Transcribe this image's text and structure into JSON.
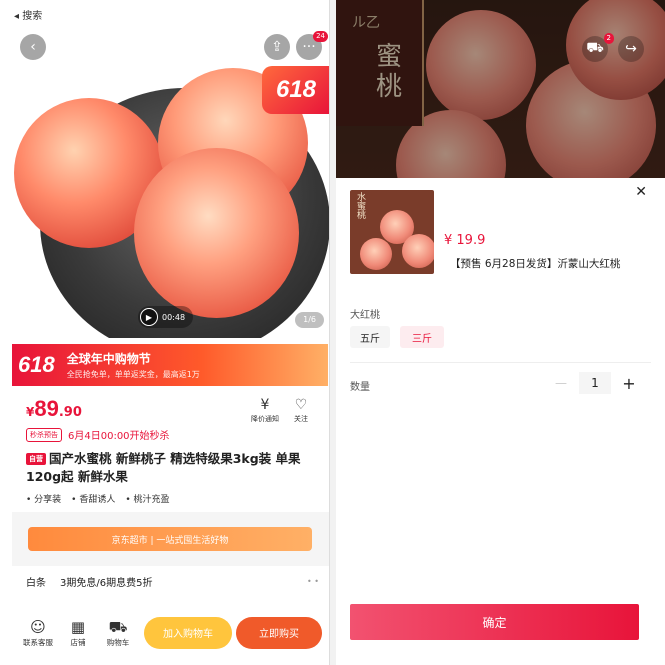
{
  "left": {
    "status": {
      "back_label": "◂ 搜索"
    },
    "nav": {
      "notif_count": "24"
    },
    "hero": {
      "badge": "618",
      "video_time": "00:48",
      "image_counter": "1/6"
    },
    "promo": {
      "badge": "618",
      "title": "全球年中购物节",
      "subtitle": "全民抢免单，单单返奖金，最高返1万"
    },
    "price": {
      "currency": "¥",
      "int": "89",
      "dec": ".90"
    },
    "actions": {
      "price_alert": "降价通知",
      "follow": "关注"
    },
    "seckill": {
      "tag": "秒杀预告",
      "text": "6月4日00:00开始秒杀"
    },
    "product": {
      "tag": "自营",
      "title": "国产水蜜桃 新鲜桃子 精选特级果3kg装 单果120g起 新鲜水果",
      "features": [
        "• 分享装",
        "• 香甜诱人",
        "• 桃汁充盈"
      ]
    },
    "banner": "京东超市 | 一站式囤生活好物",
    "baitiao": {
      "label": "白条",
      "text": "3期免息/6期息费5折"
    },
    "bottom": {
      "service": "联系客服",
      "shop": "店铺",
      "cart": "购物车",
      "add_cart": "加入购物车",
      "buy_now": "立即购买"
    }
  },
  "right": {
    "cover_label": "蜜桃",
    "cover_small": "ル乙",
    "header_notif": "2",
    "thumb_label": "水蜜桃",
    "price": "¥ 19.9",
    "product_name": "【预售 6月28日发货】沂蒙山大红桃",
    "spec_label": "大红桃",
    "options": [
      "五斤",
      "三斤"
    ],
    "qty_label": "数量",
    "qty_value": "1",
    "confirm": "确定"
  },
  "colors": {
    "accent": "#e8143a",
    "cart_yellow": "#ffc53d",
    "buy_orange": "#f05a2a"
  }
}
